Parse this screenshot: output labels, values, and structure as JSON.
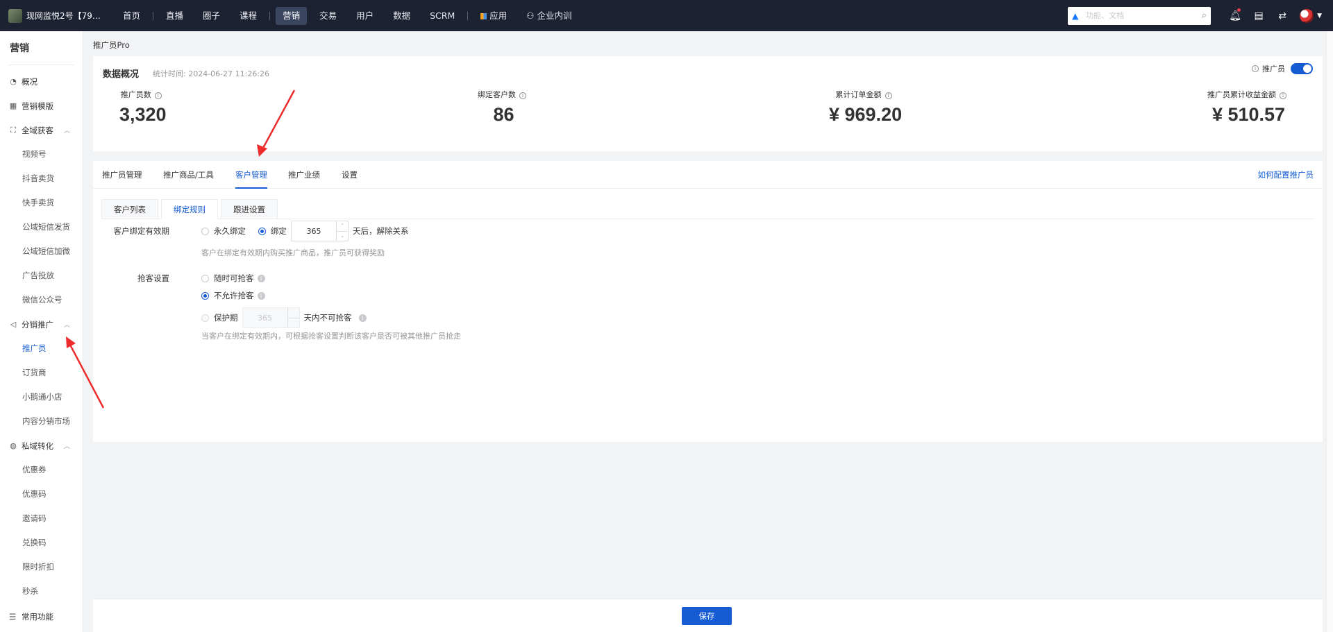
{
  "topbar": {
    "brand": "现网监悦2号【7978...",
    "nav": [
      "首页",
      "直播",
      "圈子",
      "课程",
      "营销",
      "交易",
      "用户",
      "数据",
      "SCRM"
    ],
    "apps_label": "应用",
    "training_label": "企业内训",
    "search_placeholder": "功能、文档"
  },
  "sidebar": {
    "title": "营销",
    "groups": [
      {
        "label": "概况"
      },
      {
        "label": "营销模版"
      },
      {
        "label": "全域获客",
        "items": [
          "视频号",
          "抖音卖货",
          "快手卖货",
          "公域短信发货",
          "公域短信加微",
          "广告投放",
          "微信公众号"
        ]
      },
      {
        "label": "分销推广",
        "items": [
          "推广员",
          "订货商",
          "小鹅通小店",
          "内容分销市场"
        ]
      },
      {
        "label": "私域转化",
        "items": [
          "优惠券",
          "优惠码",
          "邀请码",
          "兑换码",
          "限时折扣",
          "秒杀"
        ]
      }
    ],
    "bottom": "常用功能"
  },
  "breadcrumb": "推广员Pro",
  "overview": {
    "title": "数据概况",
    "stat_time": "统计时间: 2024-06-27 11:26:26",
    "toggle_label": "推广员",
    "toggle_on": true,
    "stats": [
      {
        "label": "推广员数",
        "value": "3,320"
      },
      {
        "label": "绑定客户数",
        "value": "86"
      },
      {
        "label": "累计订单金额",
        "value": "¥ 969.20"
      },
      {
        "label": "推广员累计收益金额",
        "value": "¥ 510.57"
      }
    ]
  },
  "tabs": [
    "推广员管理",
    "推广商品/工具",
    "客户管理",
    "推广业绩",
    "设置"
  ],
  "active_tab": "客户管理",
  "help_link": "如何配置推广员",
  "subtabs": [
    "客户列表",
    "绑定规则",
    "跟进设置"
  ],
  "active_subtab": "绑定规则",
  "form": {
    "validity_label": "客户绑定有效期",
    "opt_forever": "永久绑定",
    "opt_bind": "绑定",
    "bind_days": "365",
    "bind_suffix": "天后，解除关系",
    "validity_hint": "客户在绑定有效期内购买推广商品，推广员可获得奖励",
    "grab_label": "抢客设置",
    "opt_anytime": "随时可抢客",
    "opt_disallow": "不允许抢客",
    "opt_protect": "保护期",
    "protect_days": "365",
    "protect_suffix": "天内不可抢客",
    "grab_hint": "当客户在绑定有效期内，可根据抢客设置判断该客户是否可被其他推广员抢走",
    "selected_validity": "绑定",
    "selected_grab": "不允许抢客"
  },
  "save_label": "保存",
  "colors": {
    "accent": "#155bd4",
    "topbar": "#1d2233",
    "annotation_arrow": "#ee2b2b"
  },
  "icons": [
    "bell-icon",
    "store-icon",
    "switch-icon",
    "search-icon",
    "avatar"
  ]
}
